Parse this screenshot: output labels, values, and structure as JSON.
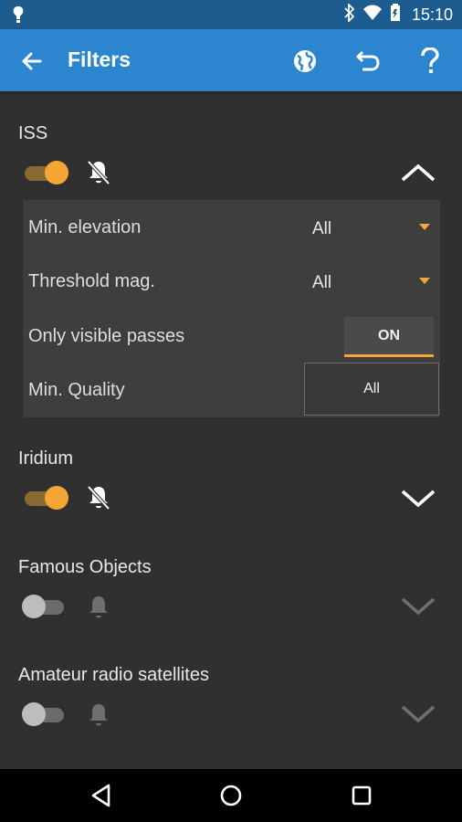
{
  "status_bar": {
    "time": "15:10",
    "icons": [
      "app-notification-icon",
      "bluetooth-icon",
      "wifi-icon",
      "battery-icon"
    ]
  },
  "app_bar": {
    "title": "Filters",
    "icons": [
      "back-arrow-icon",
      "globe-icon",
      "undo-icon",
      "help-icon"
    ]
  },
  "sections": [
    {
      "title": "ISS",
      "enabled": true,
      "notifications": "off",
      "expanded": true,
      "filters": {
        "min_elevation": {
          "label": "Min. elevation",
          "value": "All"
        },
        "threshold_mag": {
          "label": "Threshold mag.",
          "value": "All"
        },
        "only_visible": {
          "label": "Only visible passes",
          "value": "ON"
        },
        "min_quality": {
          "label": "Min. Quality",
          "value": "All"
        }
      }
    },
    {
      "title": "Iridium",
      "enabled": true,
      "notifications": "off",
      "expanded": false
    },
    {
      "title": "Famous Objects",
      "enabled": false,
      "notifications": "on",
      "expanded": false
    },
    {
      "title": "Amateur radio satellites",
      "enabled": false,
      "notifications": "on",
      "expanded": false
    }
  ],
  "colors": {
    "accent": "#f5a533",
    "app_bar": "#2b85cf",
    "status_bar": "#1d5c8e",
    "background": "#303030",
    "panel": "#3e3e3e"
  },
  "nav_bar": {
    "icons": [
      "back-triangle-icon",
      "home-circle-icon",
      "recents-square-icon"
    ]
  }
}
